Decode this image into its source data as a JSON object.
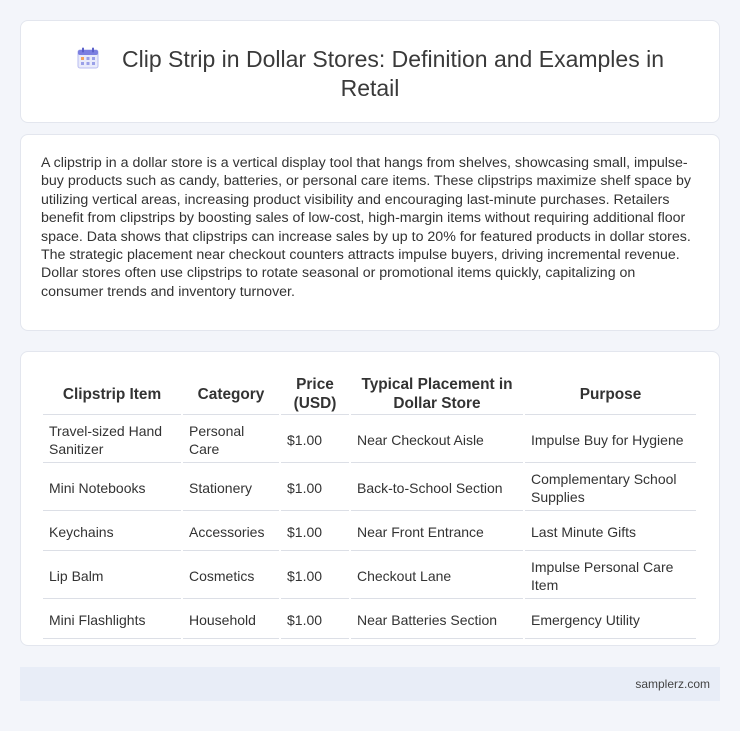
{
  "header": {
    "title": "Clip Strip in Dollar Stores: Definition and Examples in Retail",
    "icon": "calendar-icon"
  },
  "intro": {
    "text": "A clipstrip in a dollar store is a vertical display tool that hangs from shelves, showcasing small, impulse-buy products such as candy, batteries, or personal care items. These clipstrips maximize shelf space by utilizing vertical areas, increasing product visibility and encouraging last-minute purchases. Retailers benefit from clipstrips by boosting sales of low-cost, high-margin items without requiring additional floor space. Data shows that clipstrips can increase sales by up to 20% for featured products in dollar stores. The strategic placement near checkout counters attracts impulse buyers, driving incremental revenue. Dollar stores often use clipstrips to rotate seasonal or promotional items quickly, capitalizing on consumer trends and inventory turnover."
  },
  "table": {
    "headers": [
      "Clipstrip Item",
      "Category",
      "Price (USD)",
      "Typical Placement in Dollar Store",
      "Purpose"
    ],
    "rows": [
      [
        "Travel-sized Hand Sanitizer",
        "Personal Care",
        "$1.00",
        "Near Checkout Aisle",
        "Impulse Buy for Hygiene"
      ],
      [
        "Mini Notebooks",
        "Stationery",
        "$1.00",
        "Back-to-School Section",
        "Complementary School Supplies"
      ],
      [
        "Keychains",
        "Accessories",
        "$1.00",
        "Near Front Entrance",
        "Last Minute Gifts"
      ],
      [
        "Lip Balm",
        "Cosmetics",
        "$1.00",
        "Checkout Lane",
        "Impulse Personal Care Item"
      ],
      [
        "Mini Flashlights",
        "Household",
        "$1.00",
        "Near Batteries Section",
        "Emergency Utility"
      ]
    ]
  },
  "footer": {
    "site": "samplerz.com"
  },
  "colors": {
    "background": "#f3f5fa",
    "card": "#ffffff",
    "footer": "#e8edf7",
    "icon_accent": "#7b7fe0"
  }
}
